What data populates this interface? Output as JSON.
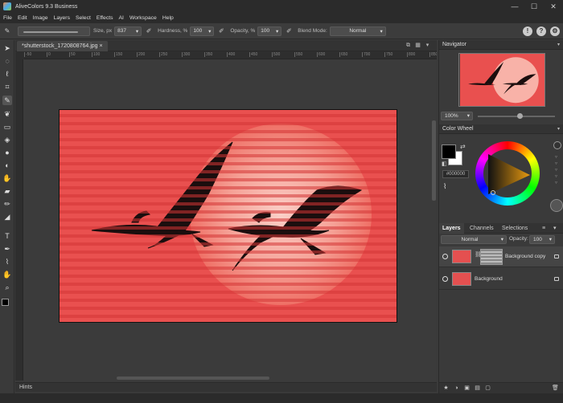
{
  "window": {
    "title": "AliveColors 9.3 Business",
    "minimize": "—",
    "maximize": "☐",
    "close": "✕"
  },
  "menu": [
    "File",
    "Edit",
    "Image",
    "Layers",
    "Select",
    "Effects",
    "AI",
    "Workspace",
    "Help"
  ],
  "options": {
    "size_label": "Size, px",
    "size_value": "837",
    "hardness_label": "Hardness, %",
    "hardness_value": "100",
    "opacity_label": "Opacity, %",
    "opacity_value": "100",
    "blend_label": "Blend Mode:",
    "blend_value": "Normal"
  },
  "document": {
    "tab_title": "*shutterstock_1720808764.jpg"
  },
  "ruler": {
    "h_marks": [
      "-50",
      "0",
      "50",
      "100",
      "150",
      "200",
      "250",
      "300",
      "350",
      "400",
      "450",
      "500",
      "550",
      "600",
      "650",
      "700",
      "750",
      "800",
      "850",
      "900"
    ]
  },
  "hints_label": "Hints",
  "navigator": {
    "title": "Navigator",
    "zoom": "100%"
  },
  "color_wheel": {
    "title": "Color Wheel",
    "hex": "#000000",
    "fg_color": "#000000",
    "bg_color": "#ffffff"
  },
  "layers_panel": {
    "tabs": [
      "Layers",
      "Channels",
      "Selections"
    ],
    "blend_mode": "Normal",
    "opacity_label": "Opacity:",
    "opacity_value": "100",
    "layers": [
      {
        "name": "Background copy",
        "selected": true
      },
      {
        "name": "Background",
        "selected": false
      }
    ]
  },
  "colors": {
    "image_red": "#e84a4a",
    "sun": "#f7a9a0",
    "stripe": "#d93c3c"
  }
}
